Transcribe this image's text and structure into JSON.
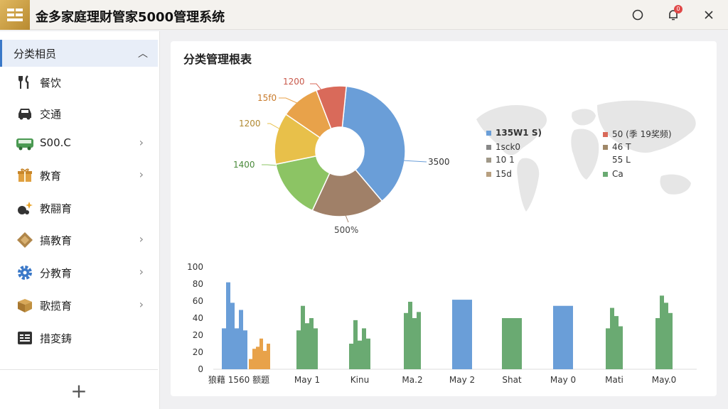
{
  "app": {
    "title": "金多家庭理财管家5000管理系统",
    "notification_count": "0"
  },
  "colors": {
    "accent": "#3a78c8",
    "blue": "#6a9ed8",
    "green": "#6aaa72",
    "orange": "#e8a24a",
    "red": "#d96a5a"
  },
  "sidebar": {
    "header": "分类相员",
    "items": [
      {
        "label": "餐饮",
        "icon": "fork-knife-icon",
        "arrow": false
      },
      {
        "label": "交通",
        "icon": "car-icon",
        "arrow": false
      },
      {
        "label": "S00.C",
        "icon": "bus-icon",
        "arrow": true
      },
      {
        "label": "教育",
        "icon": "gift-icon",
        "arrow": true
      },
      {
        "label": "教翮育",
        "icon": "sparkle-icon",
        "arrow": false
      },
      {
        "label": "搞教育",
        "icon": "diamond-icon",
        "arrow": true
      },
      {
        "label": "分教育",
        "icon": "gear-icon",
        "arrow": true
      },
      {
        "label": "歌揽育",
        "icon": "box-icon",
        "arrow": true
      },
      {
        "label": "措変鋳",
        "icon": "list-icon",
        "arrow": false
      }
    ],
    "add_label": "+"
  },
  "panel": {
    "title": "分类管理根表",
    "pie_labels": [
      "1200",
      "15f0",
      "1200",
      "1400",
      "3500",
      "500%"
    ],
    "legend": [
      {
        "label": "135W1 S)",
        "color": "#6a9ed8"
      },
      {
        "label": "50 (季 19奖频)",
        "color": "#d96a5a"
      },
      {
        "label": "1sck0",
        "color": "#888888"
      },
      {
        "label": "46 T",
        "color": "#a08868"
      },
      {
        "label": "10 1",
        "color": "#a09888"
      },
      {
        "label": "55 L",
        "color": "#cccccc"
      },
      {
        "label": "15d",
        "color": "#b8a080"
      },
      {
        "label": "Ca",
        "color": "#6aaa72"
      }
    ]
  },
  "chart_data": [
    {
      "type": "pie",
      "categories": [
        "3500",
        "500%",
        "1400",
        "1200",
        "15f0",
        "1200"
      ],
      "values": [
        3500,
        1700,
        1400,
        1200,
        900,
        700
      ],
      "colors": [
        "#6a9ed8",
        "#a08068",
        "#8cc464",
        "#e8c04a",
        "#e8a24a",
        "#d96a5a"
      ]
    },
    {
      "type": "bar",
      "categories": [
        "狼藉 1560 额题",
        "May 1",
        "Kinu",
        "Ma.2",
        "May 2",
        "Shat",
        "May 0",
        "Mati",
        "May.0"
      ],
      "ylim": [
        0,
        100
      ],
      "yticks": [
        "100",
        "80",
        "60",
        "40",
        "20",
        "20",
        "0"
      ],
      "groups": [
        {
          "color": "#6a9ed8",
          "heights": [
            40,
            85,
            65,
            40,
            58,
            38
          ],
          "color2": "#e8a24a",
          "heights2": [
            10,
            20,
            22,
            30,
            18,
            25
          ]
        },
        {
          "color": "#6aaa72",
          "heights": [
            38,
            62,
            45,
            50,
            40
          ]
        },
        {
          "color": "#6aaa72",
          "heights": [
            25,
            48,
            28,
            40,
            30
          ]
        },
        {
          "color": "#6aaa72",
          "heights": [
            55,
            66,
            50,
            56
          ]
        },
        {
          "color": "#6a9ed8",
          "heights": [
            68,
            68
          ]
        },
        {
          "color": "#6aaa72",
          "heights": [
            50,
            50
          ]
        },
        {
          "color": "#6a9ed8",
          "heights": [
            62,
            62
          ]
        },
        {
          "color": "#6aaa72",
          "heights": [
            40,
            60,
            52,
            42
          ]
        },
        {
          "color": "#6aaa72",
          "heights": [
            50,
            72,
            65,
            55
          ]
        }
      ]
    }
  ]
}
